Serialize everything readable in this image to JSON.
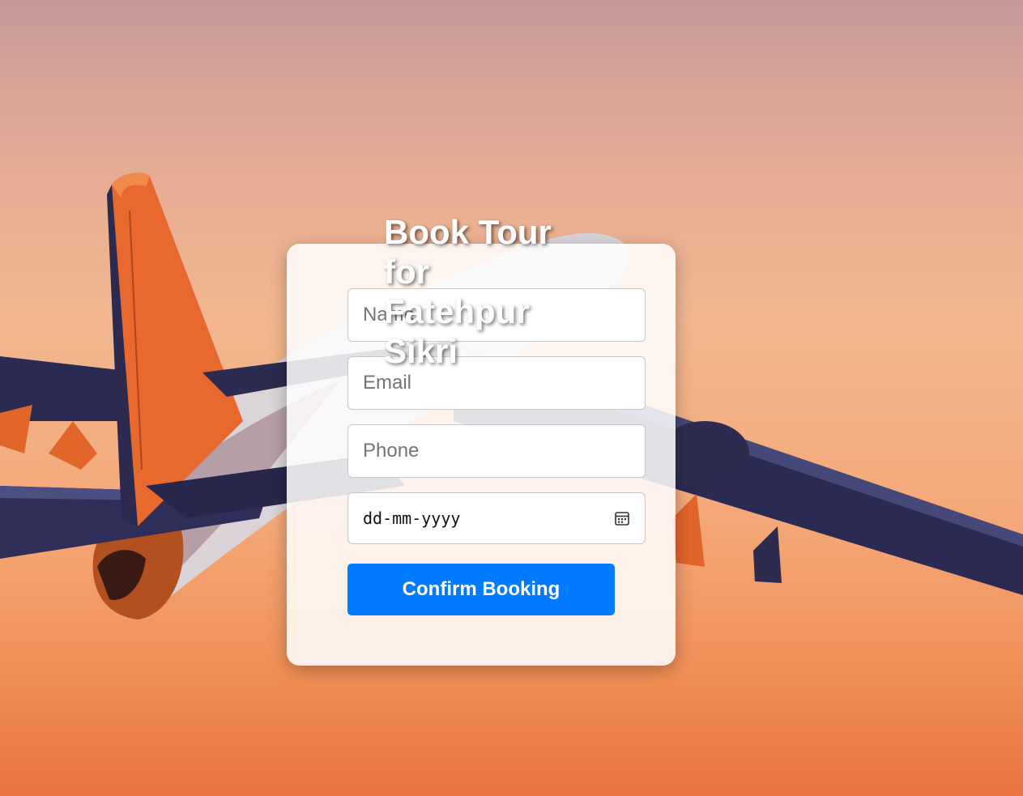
{
  "page": {
    "title": "Book Tour for Fatehpur Sikri"
  },
  "form": {
    "name": {
      "placeholder": "Name",
      "value": ""
    },
    "email": {
      "placeholder": "Email",
      "value": ""
    },
    "phone": {
      "placeholder": "Phone",
      "value": ""
    },
    "date": {
      "placeholder": "dd-mm-yyyy",
      "icon": "calendar-icon"
    },
    "submit_label": "Confirm Booking"
  },
  "colors": {
    "accent": "#007bff",
    "card_background": "#ffffff",
    "title_text": "#ffffff"
  }
}
